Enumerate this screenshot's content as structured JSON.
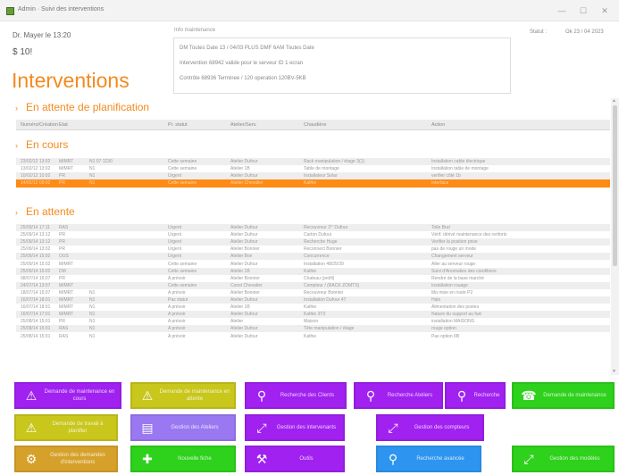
{
  "window": {
    "title": "Admin · Suivi des interventions",
    "minimize": "—",
    "maximize": "☐",
    "close": "✕"
  },
  "header": {
    "date": "Dr. Mayer le 13:20",
    "dollar": "$ 10!",
    "title": "Interventions",
    "maintenance_label": "Info maintenance",
    "maintenance_lines": [
      "DM Toutes Date 13 / 04/03 PLUS DMF 6AM Toutes Date",
      "Intervention 68942 valide pour le serveur ID 1 ecran",
      "Contrôle 68936 Terminee / 120 operation 120BV-5KB"
    ],
    "status_label": "Statut :",
    "status_value": "Ok 23 / 04 2023"
  },
  "sections": {
    "plan": "En attente de planification",
    "cours": "En cours",
    "attente": "En attente"
  },
  "columns": [
    "Numéro/Crèation",
    "Etat",
    "",
    "Pr. statut",
    "Atelier/Serv.",
    "Chaudière",
    "Action"
  ],
  "rows_en_cours": [
    [
      "23/02/12 13:02",
      "M/MRT",
      "N1 07 1230",
      "Cette semaine",
      "Atelier Dufour",
      "Rack manipulation / étage 3(1)",
      "Installation cable électrique"
    ],
    [
      "13/02/12 13:02",
      "M/MRT",
      "N1",
      "Cette semaine",
      "Atelier 1B",
      "Table de montage",
      "Installation table de montage"
    ],
    [
      "10/02/12 10:02",
      "PR",
      "N1",
      "Urgent",
      "Atelier Dufour",
      "Installateur Solar",
      "verifier côté 1b"
    ],
    [
      "14/02/12 09:02",
      "PR",
      "N1",
      "Cette semaine",
      "Atelier Chevalier",
      "Kathie",
      "Interface"
    ]
  ],
  "rows_en_attente": [
    [
      "25/09/14 17:11",
      "RAS",
      "",
      "Urgent",
      "Atelier Dufour",
      "Recouvreur 3'° Dufour",
      "Toile Brut"
    ],
    [
      "25/09/14 13:12",
      "PR",
      "",
      "Urgent",
      "Atelier Dufour",
      "Carton Dufour",
      "Vérif. dérivé maintenance des renforts"
    ],
    [
      "25/09/14 13:12",
      "PR",
      "",
      "Urgent",
      "Atelier Dufour",
      "Recherche Huge",
      "Verifier la position prise"
    ],
    [
      "25/09/14 13:02",
      "PR",
      "",
      "Urgent",
      "Atelier Bonnier",
      "Reconnect Bonnier",
      "pas de rouge un mode"
    ],
    [
      "25/09/14 15:02",
      "OUS",
      "",
      "Urgent",
      "Atelier Bon",
      "Concurrence",
      "Changement serveur"
    ],
    [
      "25/09/14 15:02",
      "M/MRT",
      "",
      "Cette semaine",
      "Atelier Dufour",
      "Installation 48/25/39",
      "Aller au serveur rouge"
    ],
    [
      "25/09/14 15:02",
      "DM",
      "",
      "Cette semaine",
      "Atelier 1B",
      "Kathie",
      "Suivi d'Anomalies des conditions"
    ],
    [
      "08/07/14 15:07",
      "PR",
      "",
      "A prévoir",
      "Atelier Bonnier",
      "Chateau (profil)",
      "Rendre de la base marché"
    ],
    [
      "24/07/14 13:07",
      "M/MRT",
      "",
      "Cette semaine",
      "Const Chevalier",
      "Compteur / (RACK ZOMTS)",
      "Installation rouage"
    ],
    [
      "18/07/14 15:07",
      "M/MRT",
      "N1",
      "A prévoir",
      "Atelier Bonnier",
      "Recouvreur Bonnier",
      "Ma mise en route P2"
    ],
    [
      "16/07/14 18:01",
      "M/MRT",
      "N1",
      "Pas statut",
      "Atelier Dufour",
      "Installation Dufour 4T",
      "Halo"
    ],
    [
      "16/07/14 18:01",
      "M/MRT",
      "N1",
      "A prévoir",
      "Atelier 1B",
      "Kathie",
      "Alimentation des postes"
    ],
    [
      "16/07/14 17:01",
      "M/MRT",
      "N1",
      "A prévoir",
      "Atelier Dufour",
      "Kathie 3T3",
      "Nature du support au fuel"
    ],
    [
      "25/08/14 15:01",
      "PR",
      "N1",
      "A prévoir",
      "Atelier",
      "Maison",
      "installation MAISONS"
    ],
    [
      "25/08/14 15:01",
      "RAS",
      "N1",
      "A prévoir",
      "Atelier Dufour",
      "Tête manipulation / étage",
      "rouge option"
    ],
    [
      "25/08/14 15:01",
      "RAS",
      "N1",
      "A prévoir",
      "Atelier Dufour",
      "Kathie",
      "Pas option 6B"
    ]
  ],
  "buttons": [
    {
      "label": "Demande de maintenance en cours",
      "icon": "⚠",
      "icon_name": "warning-icon",
      "color": "purple"
    },
    {
      "label": "Demande de maintenance en attente",
      "icon": "⚠",
      "icon_name": "warning-icon",
      "color": "olive"
    },
    {
      "label": "Recherche des Clients",
      "icon": "⚲",
      "icon_name": "search-icon",
      "color": "purple"
    },
    {
      "label": "Recherche Ateliers",
      "icon": "⚲",
      "icon_name": "search-icon",
      "color": "purple"
    },
    {
      "label": "Recherche",
      "icon": "⚲",
      "icon_name": "search-icon",
      "color": "purple"
    },
    {
      "label": "Demande de maintenance",
      "icon": "☎",
      "icon_name": "phone-icon",
      "color": "green"
    },
    {
      "label": "Demande de travail à planifier",
      "icon": "⚠",
      "icon_name": "warning-icon",
      "color": "olive"
    },
    {
      "label": "Gestion des Ateliers",
      "icon": "▤",
      "icon_name": "list-icon",
      "color": "lavender"
    },
    {
      "label": "Gestion des intervenants",
      "icon": "⤢",
      "icon_name": "expand-icon",
      "color": "purple"
    },
    {
      "label": "Gestion des compteurs",
      "icon": "⤢",
      "icon_name": "expand-icon",
      "color": "purple"
    },
    {
      "label": "Gestion des demandes d'interventions",
      "icon": "⚙",
      "icon_name": "gear-icon",
      "color": "mustard"
    },
    {
      "label": "Nouvelle fiche",
      "icon": "✚",
      "icon_name": "add-icon",
      "color": "green"
    },
    {
      "label": "Outils",
      "icon": "⚒",
      "icon_name": "tools-icon",
      "color": "purple"
    },
    {
      "label": "Recherche avancée",
      "icon": "⚲",
      "icon_name": "search-icon",
      "color": "blue"
    },
    {
      "label": "Gestion des modèles",
      "icon": "⤢",
      "icon_name": "expand-icon",
      "color": "green"
    }
  ],
  "scrollbar": {
    "up": "▲",
    "down": "▼"
  }
}
